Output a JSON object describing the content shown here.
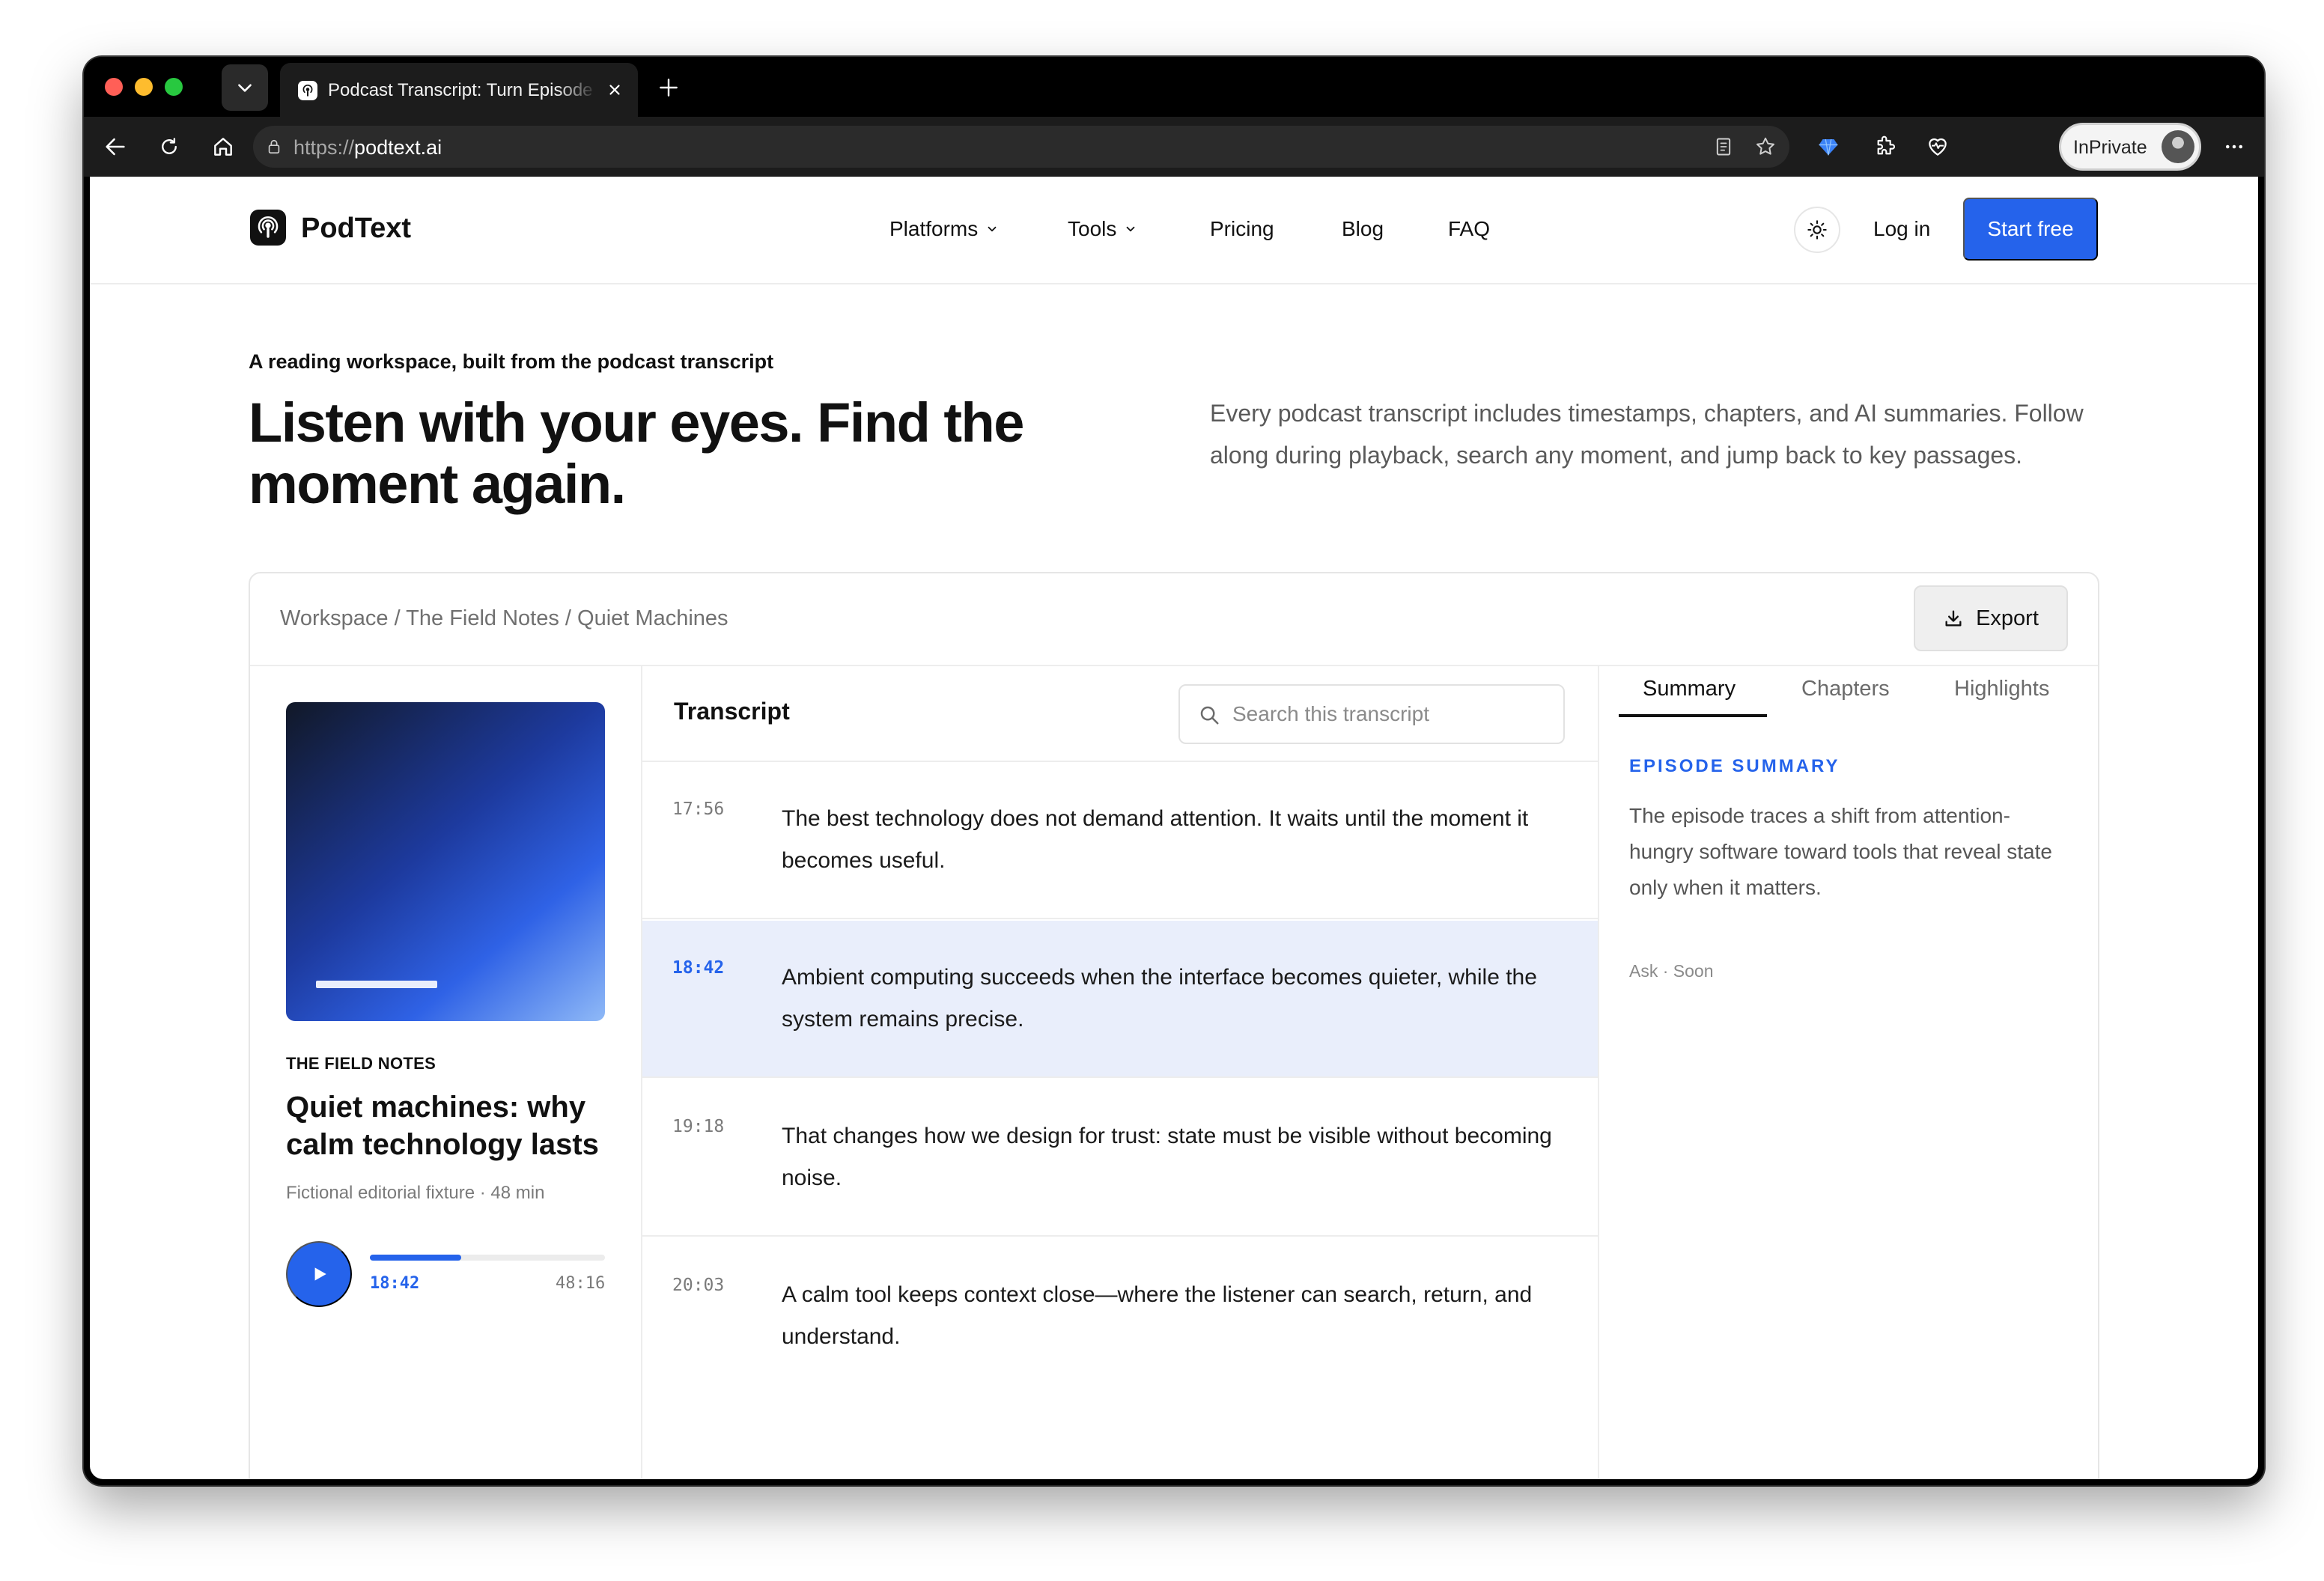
{
  "browser": {
    "tab_title": "Podcast Transcript: Turn Episode",
    "url_protocol": "https://",
    "url_host": "podtext.ai",
    "inprivate_label": "InPrivate"
  },
  "site": {
    "logo": "PodText",
    "nav": [
      {
        "label": "Platforms",
        "has_dropdown": true
      },
      {
        "label": "Tools",
        "has_dropdown": true
      },
      {
        "label": "Pricing"
      },
      {
        "label": "Blog"
      },
      {
        "label": "FAQ"
      }
    ],
    "login_label": "Log in",
    "start_label": "Start free"
  },
  "hero": {
    "eyebrow": "A reading workspace, built from the podcast transcript",
    "title": "Listen with your eyes. Find the moment again.",
    "description": "Every podcast transcript includes timestamps, chapters, and AI summaries. Follow along during playback, search any moment, and jump back to key passages."
  },
  "workspace": {
    "breadcrumb": "Workspace / The Field Notes / Quiet Machines",
    "export_label": "Export",
    "episode": {
      "show": "THE FIELD NOTES",
      "title": "Quiet machines: why calm technology lasts",
      "meta": "Fictional editorial fixture · 48 min",
      "current_time": "18:42",
      "total_time": "48:16",
      "progress": 0.39
    },
    "transcript": {
      "title": "Transcript",
      "search_placeholder": "Search this transcript",
      "segments": [
        {
          "time": "17:56",
          "text": "The best technology does not demand attention. It waits until the moment it becomes useful.",
          "active": false
        },
        {
          "time": "18:42",
          "text": "Ambient computing succeeds when the interface becomes quieter, while the system remains precise.",
          "active": true
        },
        {
          "time": "19:18",
          "text": "That changes how we design for trust: state must be visible without becoming noise.",
          "active": false
        },
        {
          "time": "20:03",
          "text": "A calm tool keeps context close—where the listener can search, return, and understand.",
          "active": false
        }
      ]
    },
    "panel": {
      "tabs": [
        "Summary",
        "Chapters",
        "Highlights"
      ],
      "active_tab": "Summary",
      "summary_label": "EPISODE SUMMARY",
      "summary_text": "The episode traces a shift from attention-hungry software toward tools that reveal state only when it matters.",
      "ask_note": "Ask · Soon"
    }
  },
  "colors": {
    "accent": "#2563eb",
    "active_row": "#e9eefb"
  }
}
